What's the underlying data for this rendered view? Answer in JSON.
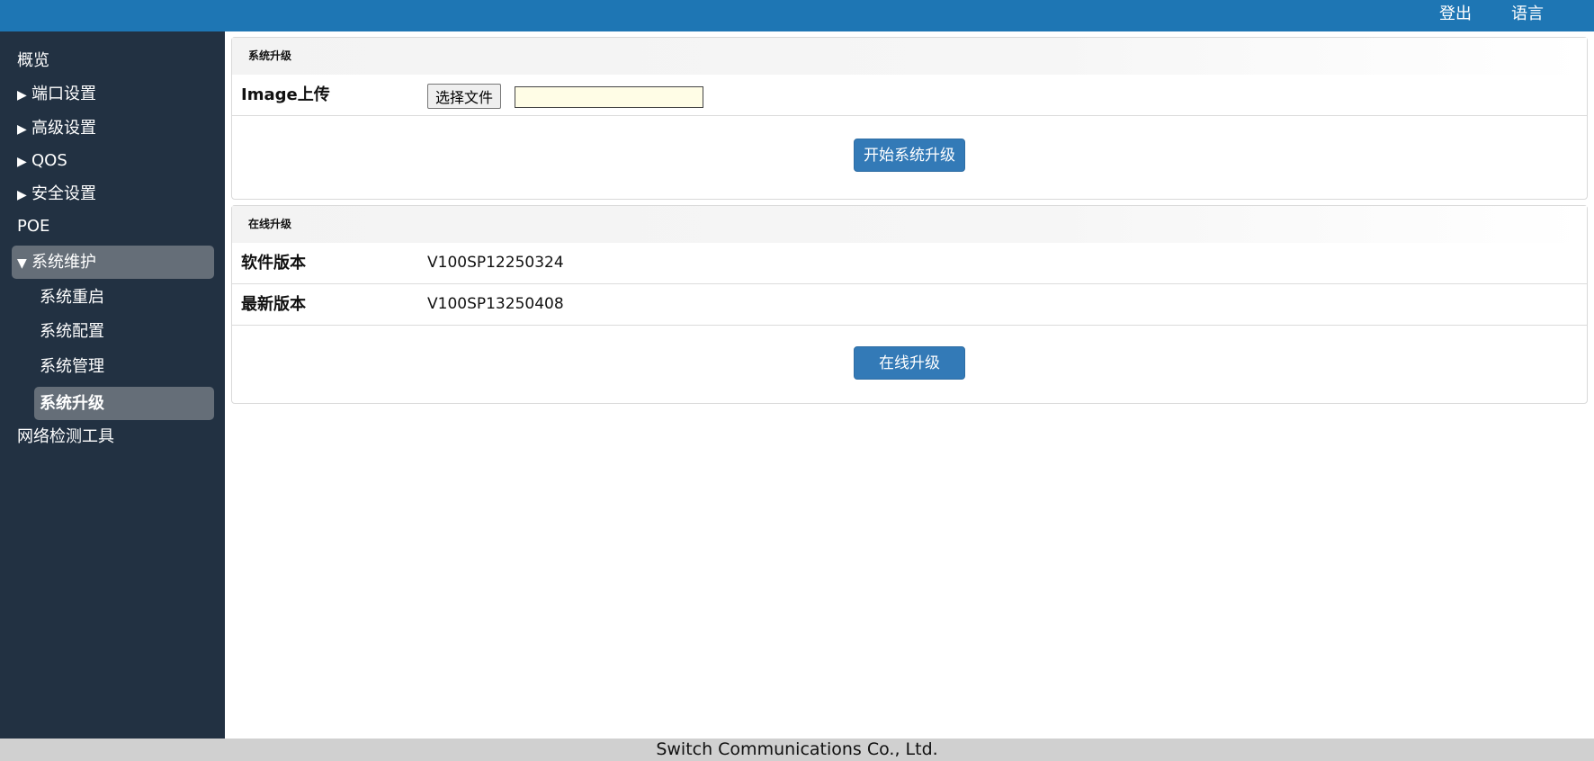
{
  "topbar": {
    "logout_label": "登出",
    "language_label": "语言",
    "bg_color": "#1e76b4"
  },
  "sidebar": {
    "items": [
      {
        "label": "概览",
        "arrow": ""
      },
      {
        "label": "端口设置",
        "arrow": "▶"
      },
      {
        "label": "高级设置",
        "arrow": "▶"
      },
      {
        "label": "QOS",
        "arrow": "▶"
      },
      {
        "label": "安全设置",
        "arrow": "▶"
      },
      {
        "label": "POE",
        "arrow": ""
      },
      {
        "label": "系统维护",
        "arrow": "▼"
      }
    ],
    "sub_items": [
      {
        "label": "系统重启"
      },
      {
        "label": "系统配置"
      },
      {
        "label": "系统管理"
      },
      {
        "label": "系统升级"
      }
    ],
    "last_item": {
      "label": "网络检测工具"
    },
    "bg_color": "#223142",
    "active_color": "#656e78"
  },
  "upgrade_panel": {
    "title": "系统升级",
    "image_label": "Image上传",
    "choose_file_label": "选择文件",
    "file_value": "",
    "start_button_label": "开始系统升级"
  },
  "online_panel": {
    "title": "在线升级",
    "software_version_label": "软件版本",
    "software_version_value": "V100SP12250324",
    "latest_version_label": "最新版本",
    "latest_version_value": "V100SP13250408",
    "online_button_label": "在线升级"
  },
  "footer": {
    "text": "Switch Communications Co., Ltd."
  },
  "accent_color": "#337ab7"
}
